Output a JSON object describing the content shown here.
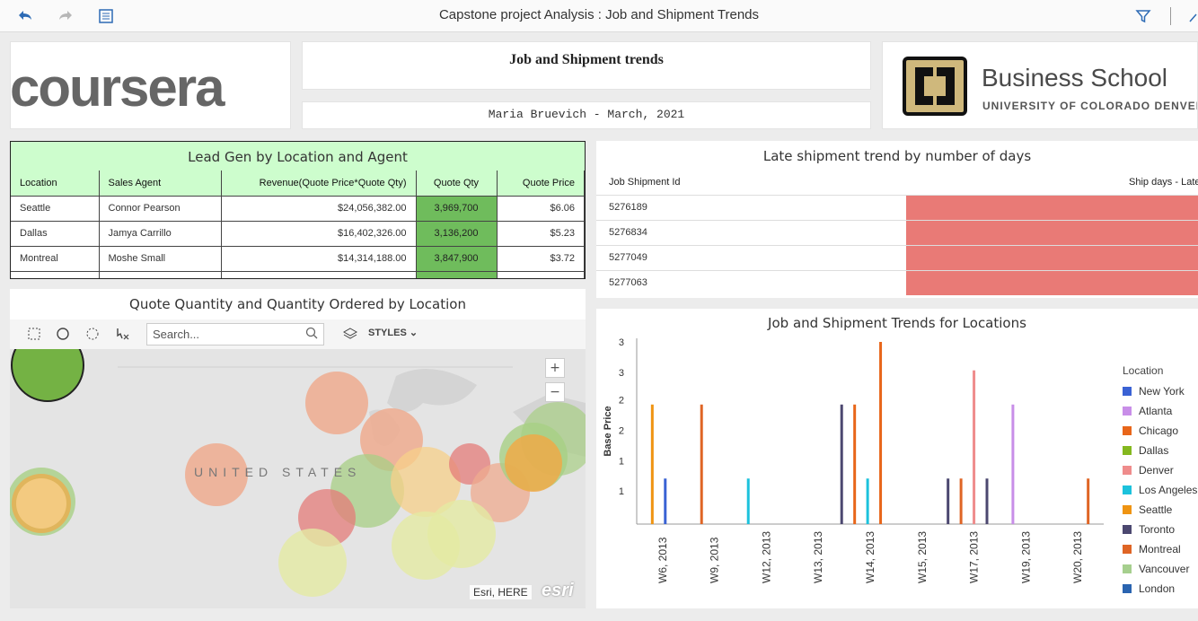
{
  "topbar": {
    "title": "Capstone project Analysis : Job and Shipment Trends",
    "undo_icon": "undo-icon",
    "redo_icon": "redo-icon",
    "list_icon": "list-icon",
    "filter_icon": "filter-icon"
  },
  "coursera": {
    "text": "coursera"
  },
  "report": {
    "title": "Job and Shipment trends",
    "author": "Maria Bruevich  - March, 2021"
  },
  "cu": {
    "name": "Business School",
    "sub": "UNIVERSITY OF COLORADO DENVER",
    "logo_text": "CU"
  },
  "leadgen": {
    "title": "Lead Gen by Location and Agent",
    "headers": [
      "Location",
      "Sales Agent",
      "Revenue(Quote Price*Quote Qty)",
      "Quote Qty",
      "Quote Price"
    ],
    "rows": [
      {
        "location": "Seattle",
        "agent": "Connor Pearson",
        "revenue": "$24,056,382.00",
        "qty": "3,969,700",
        "price": "$6.06"
      },
      {
        "location": "Dallas",
        "agent": "Jamya Carrillo",
        "revenue": "$16,402,326.00",
        "qty": "3,136,200",
        "price": "$5.23"
      },
      {
        "location": "Montreal",
        "agent": "Moshe Small",
        "revenue": "$14,314,188.00",
        "qty": "3,847,900",
        "price": "$3.72"
      }
    ],
    "qty_color": "#6fbc5c",
    "header_color": "#cdfdcd"
  },
  "late": {
    "title": "Late shipment trend by number of days",
    "col_id": "Job Shipment Id",
    "col_days": "Ship days - Late",
    "rows": [
      "5276189",
      "5276834",
      "5277049",
      "5277063"
    ],
    "bar_color": "#e97a76"
  },
  "map": {
    "title": "Quote Quantity and Quantity Ordered by Location",
    "search_placeholder": "Search...",
    "styles_label": "STYLES",
    "country_label": "UNITED STATES",
    "zoom_in": "+",
    "zoom_out": "−",
    "attribution": "Esri, HERE",
    "esri": "esri"
  },
  "chart_data": {
    "type": "bar",
    "title": "Job and Shipment Trends for Locations",
    "xlabel": "",
    "ylabel": "Base Price",
    "ytick_labels": [
      "1",
      "1",
      "2",
      "2",
      "3",
      "3"
    ],
    "ylim": [
      0,
      3.2
    ],
    "categories": [
      "W6, 2013",
      "W9, 2013",
      "W12, 2013",
      "W13, 2013",
      "W14, 2013",
      "W15, 2013",
      "W17, 2013",
      "W19, 2013",
      "W20, 2013"
    ],
    "legend_title": "Location",
    "legend_position": "right",
    "series": [
      {
        "name": "New York",
        "color": "#3a62d4"
      },
      {
        "name": "Atlanta",
        "color": "#c88ee8"
      },
      {
        "name": "Chicago",
        "color": "#e8661a"
      },
      {
        "name": "Dallas",
        "color": "#84b81f"
      },
      {
        "name": "Denver",
        "color": "#ef8c8c"
      },
      {
        "name": "Los Angeles",
        "color": "#1cc2dc"
      },
      {
        "name": "Seattle",
        "color": "#ef9412"
      },
      {
        "name": "Toronto",
        "color": "#4c4870"
      },
      {
        "name": "Montreal",
        "color": "#df6525"
      },
      {
        "name": "Vancouver",
        "color": "#a6cf8e"
      },
      {
        "name": "London",
        "color": "#2a64b0"
      }
    ],
    "bars": [
      {
        "x": 0.3,
        "series": "Seattle",
        "value": 2.1
      },
      {
        "x": 0.55,
        "series": "New York",
        "value": 0.8
      },
      {
        "x": 1.25,
        "series": "Montreal",
        "value": 2.1
      },
      {
        "x": 2.15,
        "series": "Los Angeles",
        "value": 0.8
      },
      {
        "x": 3.95,
        "series": "Toronto",
        "value": 2.1
      },
      {
        "x": 4.2,
        "series": "Chicago",
        "value": 2.1
      },
      {
        "x": 4.45,
        "series": "Los Angeles",
        "value": 0.8
      },
      {
        "x": 4.7,
        "series": "Chicago",
        "value": 3.2
      },
      {
        "x": 6.0,
        "series": "Toronto",
        "value": 0.8
      },
      {
        "x": 6.25,
        "series": "Montreal",
        "value": 0.8
      },
      {
        "x": 6.5,
        "series": "Denver",
        "value": 2.7
      },
      {
        "x": 6.75,
        "series": "Toronto",
        "value": 0.8
      },
      {
        "x": 7.25,
        "series": "Atlanta",
        "value": 2.1
      },
      {
        "x": 8.7,
        "series": "Montreal",
        "value": 0.8
      }
    ]
  }
}
